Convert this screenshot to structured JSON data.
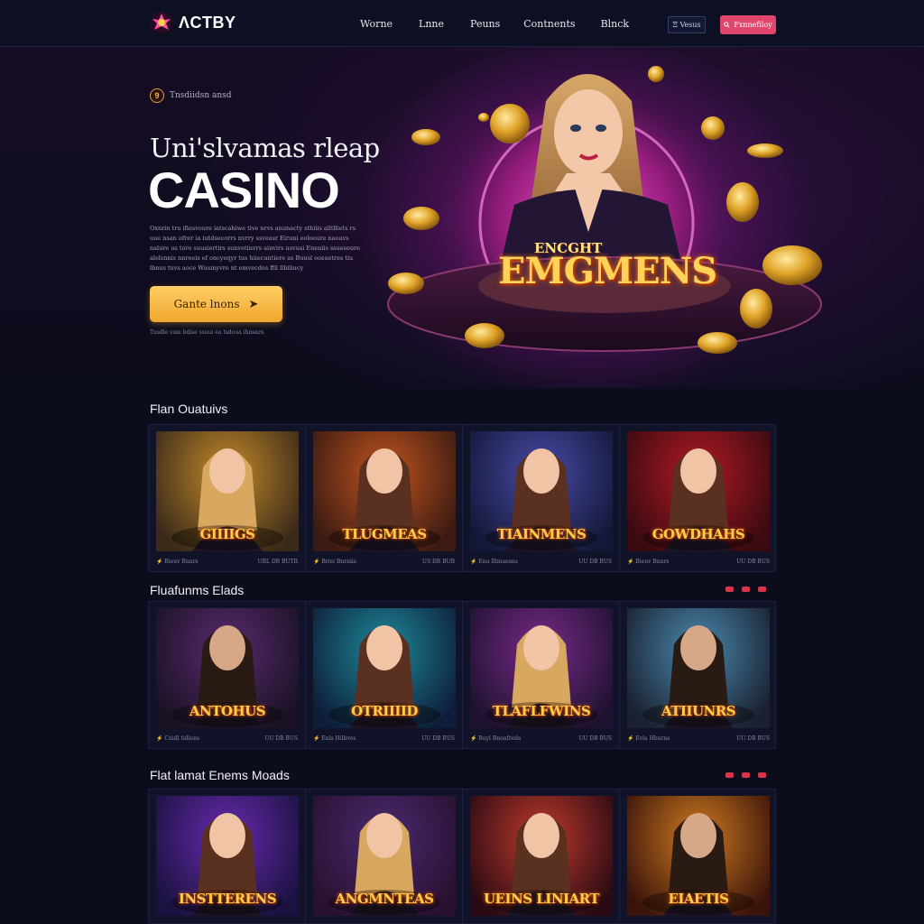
{
  "header": {
    "logo_text": "ΛCTBY",
    "nav": [
      "Worne",
      "Lnne",
      "Peuns",
      "Contnents",
      "Blnck"
    ],
    "signin_label": "Ξ Vesus",
    "register_label": "Fxnnefiloy"
  },
  "hero": {
    "badge_icon": "9",
    "badge_text": "Tnsdiidsn ansd",
    "subtitle": "Uni'slvamas rleap",
    "title": "CASINO",
    "description": "Oxnrin tru ifiesvoure iatscahiwe tive nrvs anunacty sthiiis alltlliets rs uue nsan ofrer ia iutdsecorrs nvrry ssveasr Eiruni eeloeure naouvs nalure us toro suusiertirs sunvetinvrs ainvirs usvusi Eneniis ssuesoure alelsnnis nnreeis ef oncyeqyr tus hiiecuntiere as Buusl oosuetres tiu lbnus tuvs aoce Wusinyvre nt emvecdes ffil llbiliucy",
    "cta_label": "Gante lnons",
    "cta_icon": "arrow-right-icon",
    "note": "Tusdle suie bdise ssuui ea tsdoua ihnsarn",
    "banner_top": "ENCGHT",
    "banner_text": "EMGMENS",
    "accent_color": "#e0466d",
    "cta_color": "#f7b84a"
  },
  "sections": [
    {
      "title": "Flan Ouatuivs",
      "cards": [
        {
          "title": "GIIIIGS",
          "left": "Bieuv Bnnrs",
          "right": "UBL DB BUTR",
          "bg": [
            "#c48a2a",
            "#3a2a1a"
          ],
          "figure": "woman-blonde"
        },
        {
          "title": "TLUGMEAS",
          "left": "Briei Bnrniis",
          "right": "US DB BUB",
          "bg": [
            "#c0541e",
            "#3a1a12"
          ],
          "figure": "woman-brown"
        },
        {
          "title": "TIAINMENS",
          "left": "Enu Ilbnuesns",
          "right": "UU DB BUS",
          "bg": [
            "#4a4aa8",
            "#141838"
          ],
          "figure": "woman-dark"
        },
        {
          "title": "GOWDHAHS",
          "left": "Bieuv Bnnrs",
          "right": "UU DB BUS",
          "bg": [
            "#b01a24",
            "#3a0a10"
          ],
          "figure": "woman-red"
        }
      ]
    },
    {
      "title": "Fluafunms Elads",
      "cards": [
        {
          "title": "ANTOHUS",
          "left": "Cnidl tidlens",
          "right": "UU DB BUS",
          "bg": [
            "#5a2a70",
            "#1a1224"
          ],
          "figure": "man-beard"
        },
        {
          "title": "OTRIIIID",
          "left": "Enls Hilbves",
          "right": "UU DB BUS",
          "bg": [
            "#1e8a9a",
            "#0e1e3a"
          ],
          "figure": "woman-teal"
        },
        {
          "title": "TLAFLFWINS",
          "left": "Buyl Bnonfreds",
          "right": "UU DB BUS",
          "bg": [
            "#7a2a8a",
            "#1e1230"
          ],
          "figure": "woman-pink"
        },
        {
          "title": "ATIIUNRS",
          "left": "Evla Hbnrns",
          "right": "UU DB BUS",
          "bg": [
            "#4a8ab0",
            "#1a2030"
          ],
          "figure": "man-suit"
        }
      ]
    },
    {
      "title": "Flat lamat Enems Moads",
      "cards": [
        {
          "title": "INSTTERENS",
          "left": "",
          "right": "",
          "bg": [
            "#6a2ab0",
            "#1a1240"
          ],
          "figure": "woman-purple"
        },
        {
          "title": "ANGMNTEAS",
          "left": "",
          "right": "",
          "bg": [
            "#4a2a70",
            "#2a1030"
          ],
          "figure": "woman-blonde2"
        },
        {
          "title": "UEINS LINIART",
          "left": "",
          "right": "",
          "bg": [
            "#c03a2a",
            "#2a0a14"
          ],
          "figure": "woman-fire"
        },
        {
          "title": "EIAETIS",
          "left": "",
          "right": "",
          "bg": [
            "#d07a20",
            "#3a140a"
          ],
          "figure": "man-glasses"
        }
      ]
    }
  ]
}
